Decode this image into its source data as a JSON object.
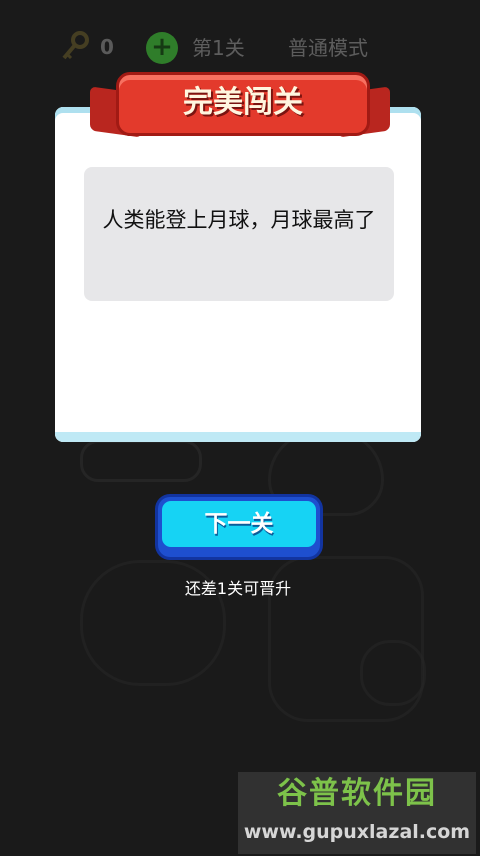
{
  "topbar": {
    "key_count": "0",
    "plus_label": "+",
    "level": "第1关",
    "mode": "普通模式"
  },
  "dialog": {
    "title": "完美闯关",
    "question": "人类能登上月球，月球最高了"
  },
  "next_button": {
    "label": "下一关"
  },
  "promo": "还差1关可晋升",
  "watermark": {
    "name": "谷普软件园",
    "url": "www.gupuxlazal.com"
  },
  "colors": {
    "ribbon": "#e33a2c",
    "button": "#16d3f4",
    "background": "#1a1a1a"
  }
}
